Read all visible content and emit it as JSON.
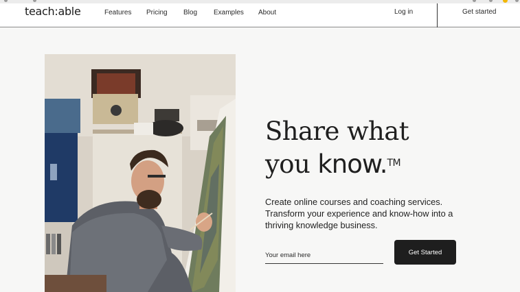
{
  "nav": {
    "logo": "teach:able",
    "links": [
      "Features",
      "Pricing",
      "Blog",
      "Examples",
      "About"
    ],
    "login": "Log in",
    "cta": "Get started"
  },
  "hero": {
    "headline_line1": "Share what",
    "headline_line2_prefix": "you ",
    "headline_line2_bold": "know.",
    "headline_mark": "TM",
    "subtext": "Create online courses and coaching services. Transform your experience and know-how into a thriving knowledge business.",
    "email_placeholder": "Your email here",
    "cta_label": "Get Started"
  },
  "colors": {
    "page_background": "#f7f7f6",
    "button_background": "#1e1e1e",
    "text": "#1f1f1f"
  }
}
